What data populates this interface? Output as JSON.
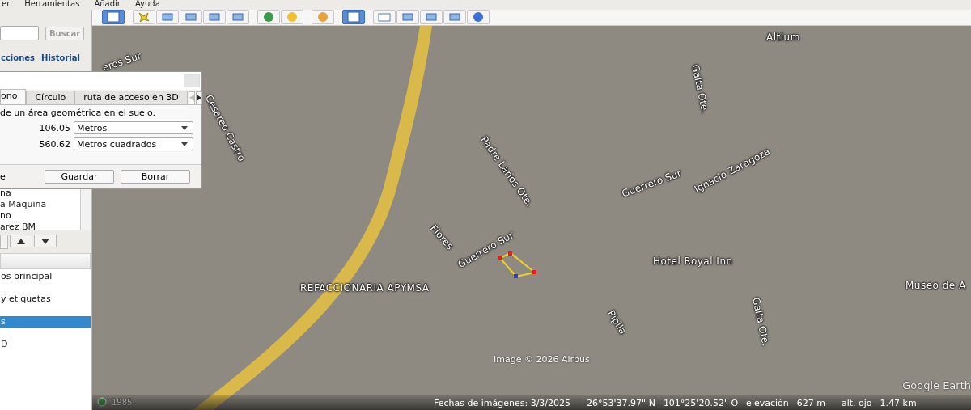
{
  "menu": [
    "er",
    "Herramientas",
    "Añadir",
    "Ayuda"
  ],
  "toolbar": [
    {
      "selected": true
    },
    {
      "selected": false
    },
    {
      "selected": false
    },
    {
      "selected": false
    },
    {
      "selected": false
    },
    {
      "selected": false
    },
    {
      "selected": false
    },
    {
      "selected": false
    },
    {
      "selected": false
    },
    {
      "selected": true
    },
    {
      "selected": false
    },
    {
      "selected": false
    },
    {
      "selected": false
    },
    {
      "selected": false
    },
    {
      "selected": false
    }
  ],
  "search": {
    "button": "Buscar"
  },
  "panel_tabs": [
    {
      "label": "cciones",
      "selected": false
    },
    {
      "label": "Historial",
      "selected": false
    }
  ],
  "places": [
    "na",
    "a Maquina",
    "no",
    "arez BM"
  ],
  "layers": {
    "items": [
      {
        "label": "os principal",
        "selected": false
      },
      {
        "label": "y etiquetas",
        "selected": false
      },
      {
        "label": "s",
        "selected": true
      },
      {
        "label": "D",
        "selected": false
      }
    ]
  },
  "dialog": {
    "tabs": [
      {
        "label": "ono",
        "selected": true
      },
      {
        "label": "Círculo",
        "selected": false
      },
      {
        "label": "ruta de acceso en 3D",
        "selected": false
      }
    ],
    "description": "de un área geométrica en el suelo.",
    "rows": [
      {
        "value": "106.05",
        "unit": "Metros"
      },
      {
        "value": "560.62",
        "unit": "Metros cuadrados"
      }
    ],
    "footer_label": "e",
    "buttons": [
      "Guardar",
      "Borrar"
    ]
  },
  "map": {
    "labels": [
      {
        "text": "eros Sur",
        "kind": "street"
      },
      {
        "text": "Cesareo Castro",
        "kind": "street"
      },
      {
        "text": "Padre Larios Ote.",
        "kind": "street"
      },
      {
        "text": "Galta Ote.",
        "kind": "street"
      },
      {
        "text": "Altium",
        "kind": "place"
      },
      {
        "text": "Guerrero Sur",
        "kind": "street"
      },
      {
        "text": "Ignacio Zaragoza",
        "kind": "street"
      },
      {
        "text": "Flores",
        "kind": "street"
      },
      {
        "text": "Guerrero Sur",
        "kind": "street"
      },
      {
        "text": "Hotel Royal Inn",
        "kind": "place"
      },
      {
        "text": "REFACCIONARIA APYMSA",
        "kind": "place"
      },
      {
        "text": "Pipila",
        "kind": "street"
      },
      {
        "text": "Galta Ote.",
        "kind": "street"
      },
      {
        "text": "Museo de A",
        "kind": "place"
      }
    ],
    "attribution": "Image © 2026 Airbus",
    "logo": "Google Earth",
    "history_year": "1985"
  },
  "status_bar": {
    "date": "Fechas de imágenes: 3/3/2025",
    "lat": "26°53'37.97\" N",
    "lon": "101°25'20.52\" O",
    "elevation_label": "elevación",
    "elevation": "627 m",
    "eye_label": "alt. ojo",
    "eye": "1.47 km"
  }
}
